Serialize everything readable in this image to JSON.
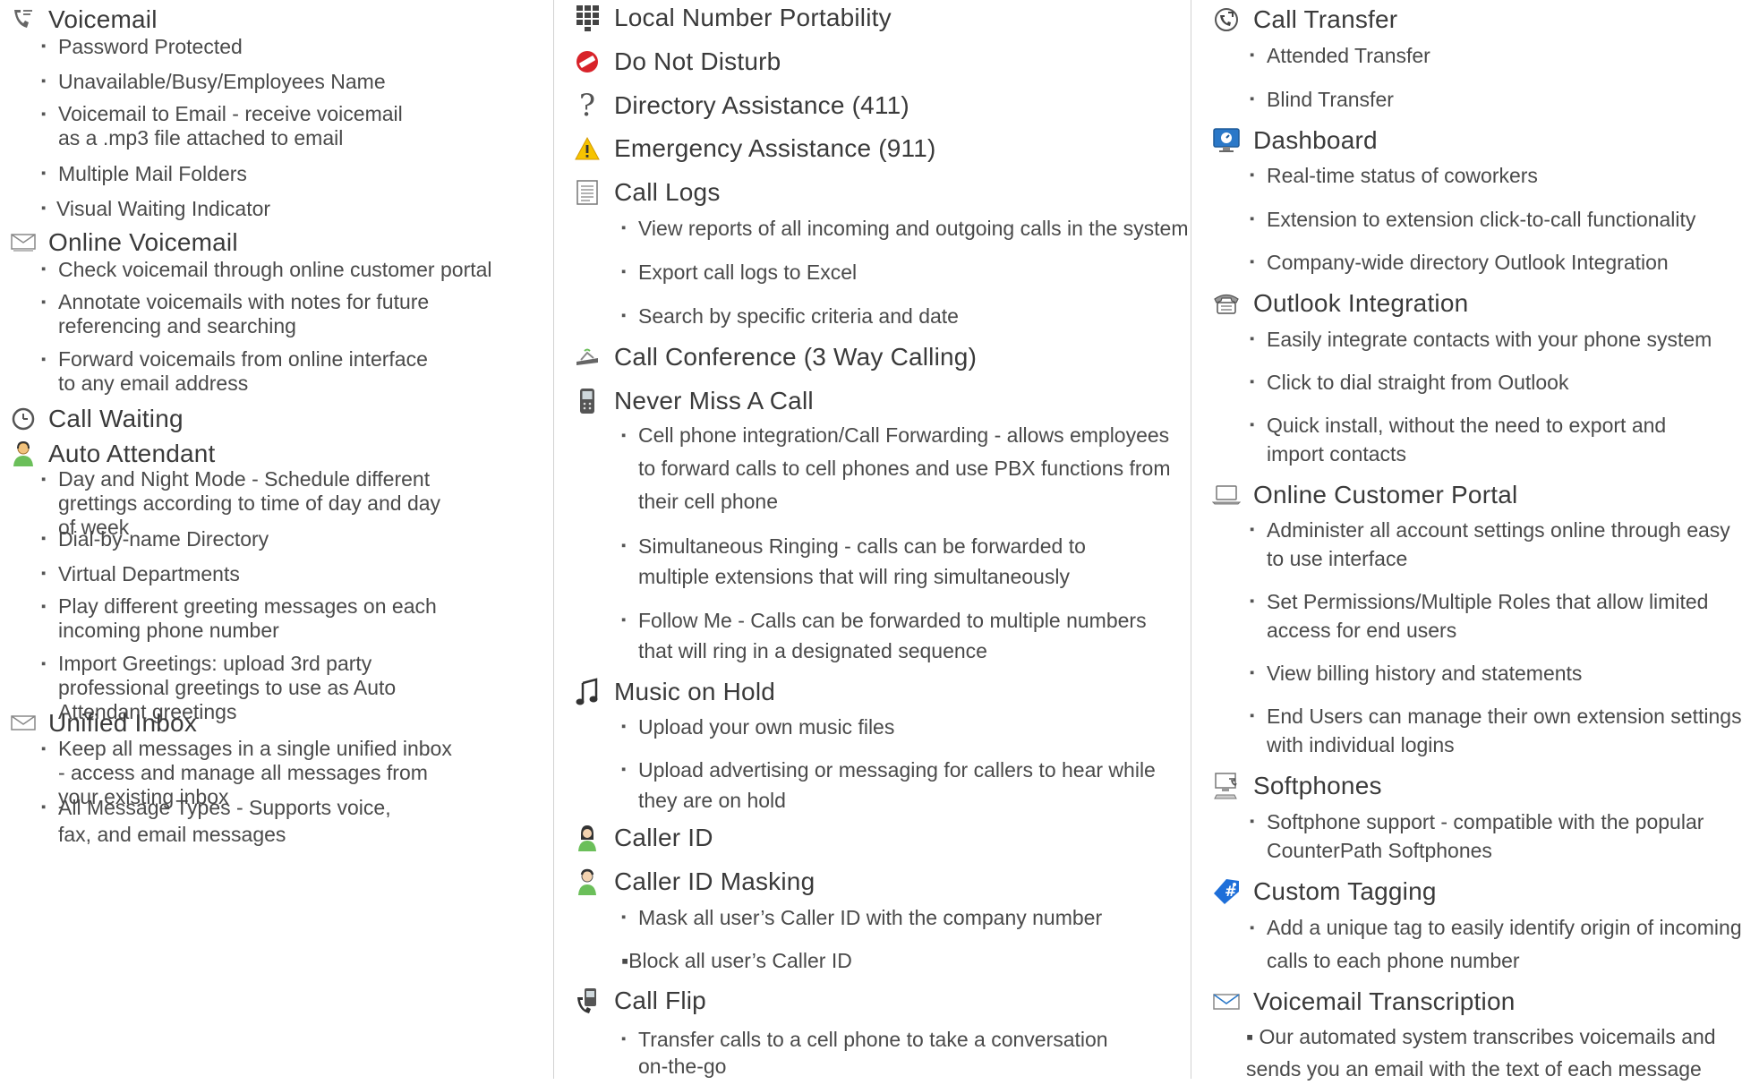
{
  "col1": {
    "voicemail": {
      "title": "Voicemail",
      "items": [
        "Password Protected",
        "Unavailable/Busy/Employees Name",
        "Voicemail to Email - receive voicemail as a .mp3 file attached to email",
        "Multiple Mail Folders",
        "Visual Waiting Indicator"
      ]
    },
    "online_voicemail": {
      "title": "Online Voicemail",
      "items": [
        "Check voicemail through online customer portal",
        "Annotate voicemails with notes for future referencing and searching",
        "Forward voicemails from online interface to any email address"
      ]
    },
    "call_waiting": {
      "title": "Call Waiting"
    },
    "auto_attendant": {
      "title": "Auto Attendant",
      "items": [
        "Day and Night Mode - Schedule different grettings according to time of day and day of week",
        "Dial-by-name Directory",
        "Virtual Departments",
        "Play different greeting messages on each incoming phone number",
        "Import Greetings: upload 3rd party professional greetings to use as Auto Attendant greetings"
      ]
    },
    "unified_inbox": {
      "title": "Unified Inbox",
      "items": [
        "Keep all messages in a single unified inbox - access and manage all messages from your existing inbox",
        "All Message Types - Supports voice, fax, and email messages"
      ]
    }
  },
  "col2": {
    "lnp": {
      "title": "Local Number Portability"
    },
    "dnd": {
      "title": "Do Not Disturb"
    },
    "directory": {
      "title": "Directory Assistance (411)"
    },
    "emergency": {
      "title": "Emergency Assistance (911)"
    },
    "call_logs": {
      "title": "Call Logs",
      "items": [
        "View reports of all incoming and outgoing calls in the system",
        "Export call logs to Excel",
        "Search by specific criteria and date"
      ]
    },
    "conference": {
      "title": "Call Conference (3 Way Calling)"
    },
    "never_miss": {
      "title": "Never Miss A Call",
      "items": [
        "Cell phone integration/Call Forwarding - allows employees to forward calls to cell phones and use PBX functions from their cell phone",
        "Simultaneous Ringing - calls can be forwarded to multiple extensions that will ring simultaneously",
        "Follow Me - Calls can be forwarded to multiple numbers that will ring in a designated sequence"
      ]
    },
    "music": {
      "title": "Music on Hold",
      "items": [
        "Upload your own music files",
        "Upload advertising or messaging for callers to hear while they are on hold"
      ]
    },
    "caller_id": {
      "title": "Caller ID"
    },
    "masking": {
      "title": "Caller ID Masking",
      "items": [
        "Mask all user’s Caller ID with the company number",
        "▪Block all user’s Caller ID"
      ]
    },
    "call_flip": {
      "title": "Call Flip",
      "items": [
        "Transfer calls to a cell phone to take a conversation on-the-go"
      ]
    }
  },
  "col3": {
    "transfer": {
      "title": "Call Transfer",
      "items": [
        "Attended Transfer",
        "Blind Transfer"
      ]
    },
    "dashboard": {
      "title": "Dashboard",
      "items": [
        "Real-time status of coworkers",
        "Extension to extension click-to-call functionality",
        "Company-wide directory Outlook Integration"
      ]
    },
    "outlook": {
      "title": "Outlook Integration",
      "items": [
        "Easily integrate contacts with your phone system",
        "Click to dial straight from Outlook",
        "Quick install, without the need to export and import contacts"
      ]
    },
    "portal": {
      "title": "Online Customer Portal",
      "items": [
        "Administer all account settings online through easy to use interface",
        "Set Permissions/Multiple Roles that allow limited access for end users",
        "View billing history and statements",
        "End Users can manage their own extension settings with individual logins"
      ]
    },
    "softphones": {
      "title": "Softphones",
      "items": [
        "Softphone support - compatible with the popular CounterPath Softphones"
      ]
    },
    "tagging": {
      "title": "Custom Tagging",
      "items": [
        "Add a unique tag to easily identify origin of incoming calls to each phone number"
      ]
    },
    "transcription": {
      "title": "Voicemail Transcription",
      "items": [
        "▪ Our automated system transcribes voicemails and sends you an email with the text of each message"
      ]
    }
  },
  "colors": {
    "text": "#4a4a4a",
    "heading": "#3a3a3a",
    "divider": "#d2d2d2",
    "dnd_red": "#d8232a",
    "warning_yellow": "#f6c300",
    "tag_blue": "#1e6fd9",
    "monitor_blue": "#2a78c8",
    "person_green": "#6bbf5a"
  }
}
